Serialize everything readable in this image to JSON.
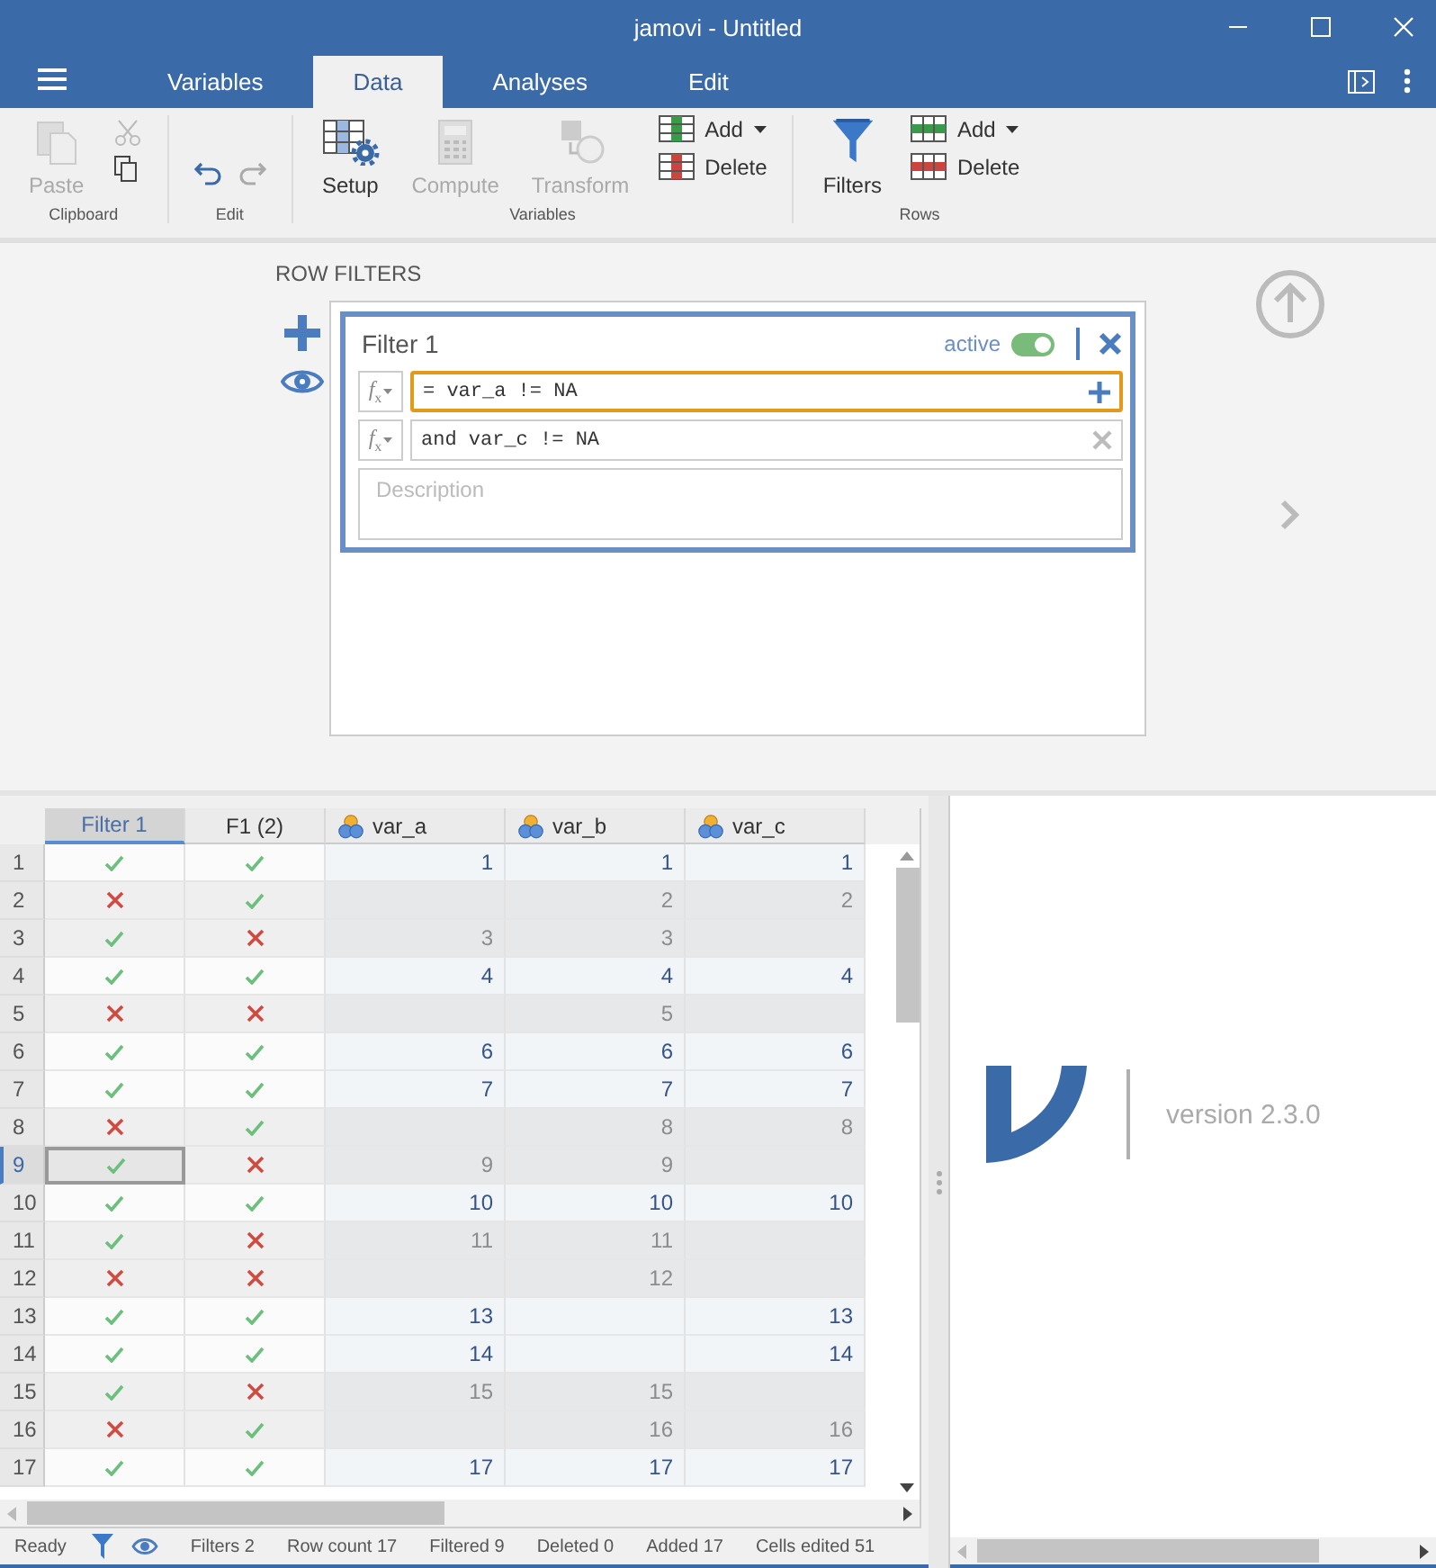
{
  "window": {
    "title": "jamovi - Untitled"
  },
  "tabs": [
    {
      "label": "Variables",
      "selected": false
    },
    {
      "label": "Data",
      "selected": true
    },
    {
      "label": "Analyses",
      "selected": false
    },
    {
      "label": "Edit",
      "selected": false
    }
  ],
  "ribbon": {
    "clipboard": {
      "label": "Clipboard",
      "paste": {
        "label": "Paste",
        "disabled": true
      },
      "cut": {
        "disabled": true
      },
      "copy": {
        "disabled": false
      }
    },
    "edit": {
      "label": "Edit",
      "undo": {
        "disabled": false
      },
      "redo": {
        "disabled": true
      }
    },
    "variables": {
      "label": "Variables",
      "setup": {
        "label": "Setup",
        "disabled": false
      },
      "compute": {
        "label": "Compute",
        "disabled": true
      },
      "transform": {
        "label": "Transform",
        "disabled": true
      },
      "add": {
        "label": "Add"
      },
      "delete": {
        "label": "Delete"
      }
    },
    "rows": {
      "label": "Rows",
      "filters": {
        "label": "Filters"
      },
      "add": {
        "label": "Add"
      },
      "delete": {
        "label": "Delete"
      }
    }
  },
  "row_filters": {
    "title": "ROW FILTERS",
    "filter": {
      "name": "Filter 1",
      "active_label": "active",
      "active": true,
      "expressions": [
        {
          "function_label": "*f*$_{x}$",
          "text": "= var_a != NA",
          "focused": true
        },
        {
          "function_label": "*f*$_{x}$",
          "text": "and var_c != NA",
          "focused": false
        }
      ],
      "description_placeholder": "Description"
    }
  },
  "grid": {
    "columns": [
      {
        "label": "Filter 1",
        "kind": "filter",
        "selected": true
      },
      {
        "label": "F1 (2)",
        "kind": "filter",
        "selected": false
      },
      {
        "label": "var_a",
        "kind": "variable",
        "selected": false
      },
      {
        "label": "var_b",
        "kind": "variable",
        "selected": false
      },
      {
        "label": "var_c",
        "kind": "variable",
        "selected": false
      }
    ],
    "rows": [
      {
        "number": "1",
        "filters": [
          true,
          true
        ],
        "var_a": "1",
        "var_b": "1",
        "var_c": "1",
        "filtered": false,
        "selected": false
      },
      {
        "number": "2",
        "filters": [
          false,
          true
        ],
        "var_b": "2",
        "var_c": "2",
        "filtered": true,
        "selected": false
      },
      {
        "number": "3",
        "filters": [
          true,
          false
        ],
        "var_a": "3",
        "var_b": "3",
        "filtered": true,
        "selected": false
      },
      {
        "number": "4",
        "filters": [
          true,
          true
        ],
        "var_a": "4",
        "var_b": "4",
        "var_c": "4",
        "filtered": false,
        "selected": false
      },
      {
        "number": "5",
        "filters": [
          false,
          false
        ],
        "var_b": "5",
        "filtered": true,
        "selected": false
      },
      {
        "number": "6",
        "filters": [
          true,
          true
        ],
        "var_a": "6",
        "var_b": "6",
        "var_c": "6",
        "filtered": false,
        "selected": false
      },
      {
        "number": "7",
        "filters": [
          true,
          true
        ],
        "var_a": "7",
        "var_b": "7",
        "var_c": "7",
        "filtered": false,
        "selected": false
      },
      {
        "number": "8",
        "filters": [
          false,
          true
        ],
        "var_b": "8",
        "var_c": "8",
        "filtered": true,
        "selected": false
      },
      {
        "number": "9",
        "filters": [
          true,
          false
        ],
        "var_a": "9",
        "var_b": "9",
        "filtered": true,
        "selected": true
      },
      {
        "number": "10",
        "filters": [
          true,
          true
        ],
        "var_a": "10",
        "var_b": "10",
        "var_c": "10",
        "filtered": false,
        "selected": false
      },
      {
        "number": "11",
        "filters": [
          true,
          false
        ],
        "var_a": "11",
        "var_b": "11",
        "filtered": true,
        "selected": false
      },
      {
        "number": "12",
        "filters": [
          false,
          false
        ],
        "var_b": "12",
        "filtered": true,
        "selected": false
      },
      {
        "number": "13",
        "filters": [
          true,
          true
        ],
        "var_a": "13",
        "var_c": "13",
        "filtered": false,
        "selected": false
      },
      {
        "number": "14",
        "filters": [
          true,
          true
        ],
        "var_a": "14",
        "var_c": "14",
        "filtered": false,
        "selected": false
      },
      {
        "number": "15",
        "filters": [
          true,
          false
        ],
        "var_a": "15",
        "var_b": "15",
        "filtered": true,
        "selected": false
      },
      {
        "number": "16",
        "filters": [
          false,
          true
        ],
        "var_b": "16",
        "var_c": "16",
        "filtered": true,
        "selected": false
      },
      {
        "number": "17",
        "filters": [
          true,
          true
        ],
        "var_a": "17",
        "var_b": "17",
        "var_c": "17",
        "filtered": false,
        "selected": false
      }
    ]
  },
  "status_bar": {
    "state": "Ready",
    "items": [
      "Filters 2",
      "Row count 17",
      "Filtered 9",
      "Deleted 0",
      "Added 17",
      "Cells edited 51"
    ]
  },
  "results": {
    "version": "version 2.3.0"
  }
}
